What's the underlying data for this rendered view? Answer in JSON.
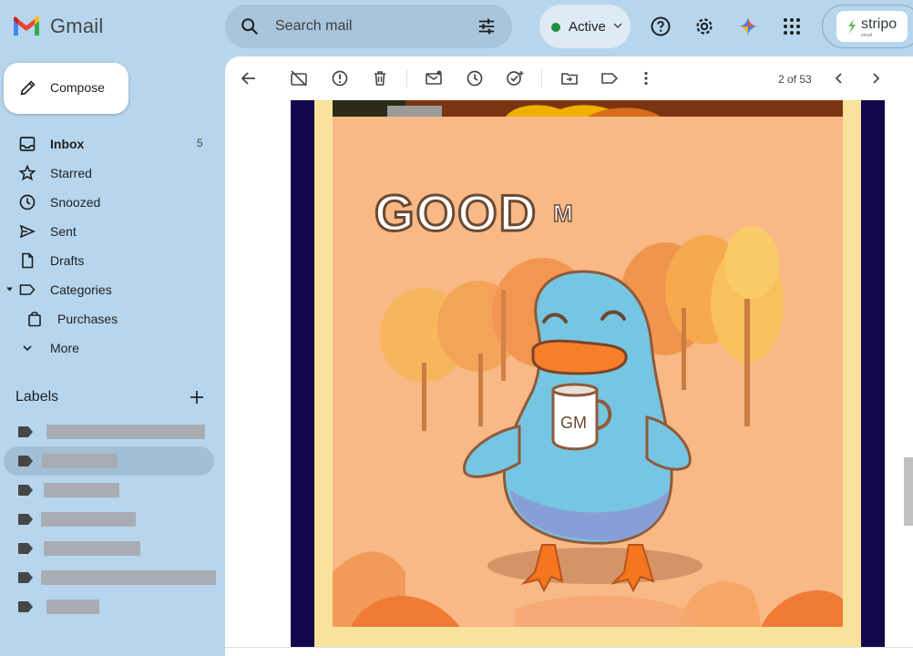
{
  "app": {
    "logo_text": "Gmail"
  },
  "search": {
    "placeholder": "Search mail",
    "value": ""
  },
  "status": {
    "label": "Active",
    "color": "#1e8e3e"
  },
  "account": {
    "brand": "stripo",
    "brand_sub": "email"
  },
  "sidebar": {
    "compose_label": "Compose",
    "items": [
      {
        "label": "Inbox",
        "count": "5",
        "icon": "inbox-icon"
      },
      {
        "label": "Starred",
        "count": "",
        "icon": "star-icon"
      },
      {
        "label": "Snoozed",
        "count": "",
        "icon": "clock-icon"
      },
      {
        "label": "Sent",
        "count": "",
        "icon": "send-icon"
      },
      {
        "label": "Drafts",
        "count": "",
        "icon": "draft-icon"
      },
      {
        "label": "Categories",
        "count": "",
        "icon": "label-icon"
      },
      {
        "label": "Purchases",
        "count": "",
        "icon": "bag-icon"
      },
      {
        "label": "More",
        "count": "",
        "icon": "chevron-down-icon"
      }
    ],
    "labels_title": "Labels"
  },
  "toolbar": {
    "pager": "2 of 53"
  },
  "email": {
    "headline": "GOOD",
    "headline_partial": "M",
    "mug_text": "GM"
  },
  "colors": {
    "background": "#b7d6ee",
    "frame": "#f9e29c",
    "art_bg": "#f8b987",
    "email_bg": "#12074a",
    "duck": "#76c6e3"
  }
}
